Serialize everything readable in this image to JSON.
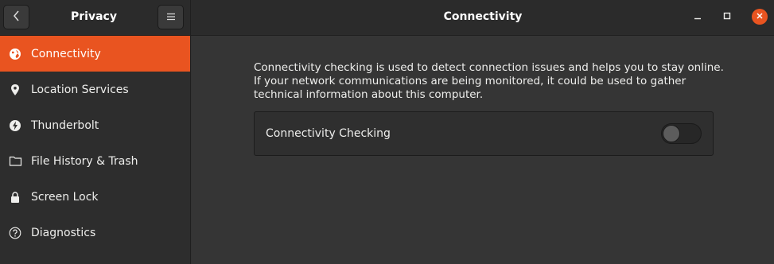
{
  "header": {
    "sidebar_title": "Privacy",
    "main_title": "Connectivity",
    "back_icon": "chevron-left-icon",
    "menu_icon": "hamburger-menu-icon"
  },
  "window_controls": {
    "minimize_icon": "minimize-icon",
    "maximize_icon": "maximize-icon",
    "close_icon": "close-icon",
    "close_color": "#e95420"
  },
  "sidebar": {
    "accent_color": "#e95420",
    "items": [
      {
        "label": "Connectivity",
        "icon": "globe-icon",
        "active": true
      },
      {
        "label": "Location Services",
        "icon": "location-pin-icon",
        "active": false
      },
      {
        "label": "Thunderbolt",
        "icon": "thunderbolt-icon",
        "active": false
      },
      {
        "label": "File History & Trash",
        "icon": "folder-icon",
        "active": false
      },
      {
        "label": "Screen Lock",
        "icon": "lock-icon",
        "active": false
      },
      {
        "label": "Diagnostics",
        "icon": "help-icon",
        "active": false
      }
    ]
  },
  "main": {
    "description_lines": [
      "Connectivity checking is used to detect connection issues and helps you to stay online.",
      "If your network communications are being monitored, it could be used to gather",
      "technical information about this computer."
    ],
    "setting": {
      "label": "Connectivity Checking",
      "enabled": false
    }
  }
}
